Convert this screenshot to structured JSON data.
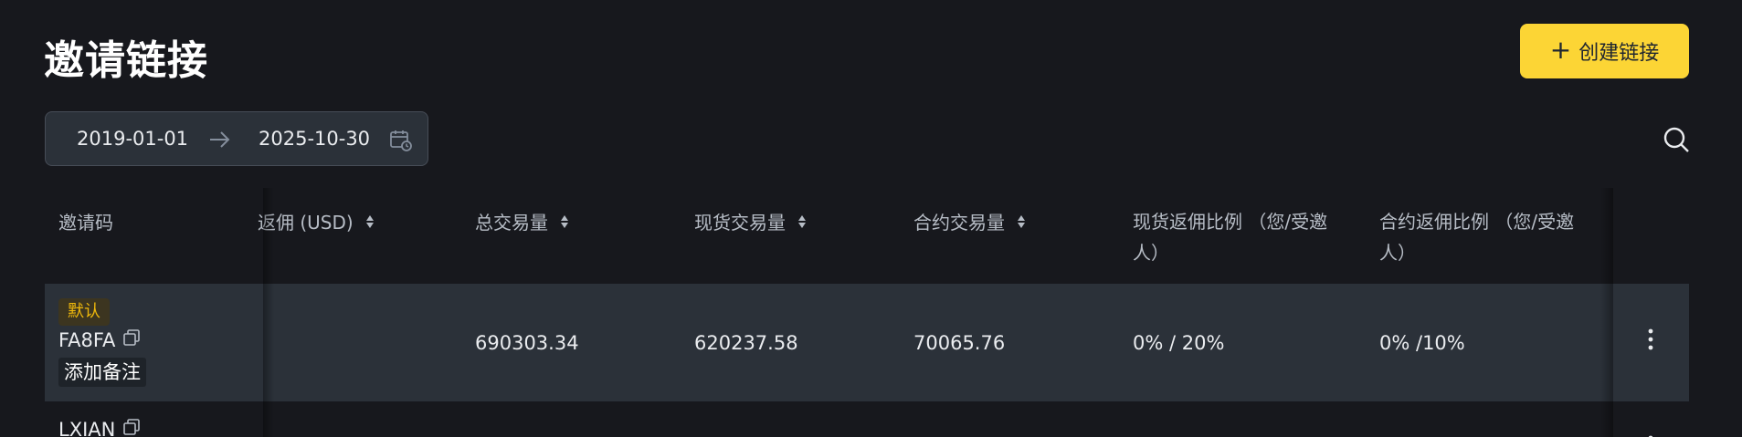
{
  "page": {
    "title": "邀请链接",
    "create_button": {
      "icon": "plus-icon",
      "label": "创建链接"
    }
  },
  "date_range": {
    "start": "2019-01-01",
    "end": "2025-10-30",
    "separator_icon": "arrow-right-icon",
    "calendar_icon": "calendar-icon"
  },
  "toolbar": {
    "search_icon": "search-icon"
  },
  "table": {
    "columns": [
      {
        "label": "邀请码",
        "sortable": false
      },
      {
        "label": "返佣 (USD)",
        "sortable": true
      },
      {
        "label": "总交易量",
        "sortable": true
      },
      {
        "label": "现货交易量",
        "sortable": true
      },
      {
        "label": "合约交易量",
        "sortable": true
      },
      {
        "label": "现货返佣比例 （您/受邀人）",
        "sortable": false
      },
      {
        "label": "合约返佣比例 （您/受邀人）",
        "sortable": false
      }
    ],
    "rows": [
      {
        "badge": "默认",
        "code": "FA8FA",
        "note_button": "添加备注",
        "rebate_usd": "",
        "total_volume": "690303.34",
        "spot_volume": "620237.58",
        "futures_volume": "70065.76",
        "spot_ratio": "0% / 20%",
        "futures_ratio": "0% /10%"
      },
      {
        "code": "LXIAN"
      }
    ]
  },
  "colors": {
    "accent": "#fcd535",
    "background": "#17181d",
    "row_highlight": "#2b3139"
  }
}
